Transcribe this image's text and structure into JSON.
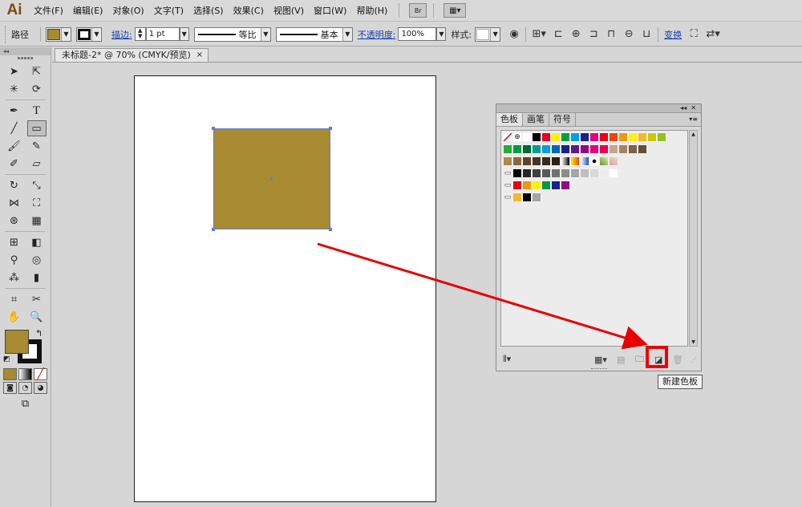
{
  "app": {
    "logo": "Ai"
  },
  "menu": {
    "items": [
      "文件(F)",
      "编辑(E)",
      "对象(O)",
      "文字(T)",
      "选择(S)",
      "效果(C)",
      "视图(V)",
      "窗口(W)",
      "帮助(H)"
    ],
    "bridge_label": "Br",
    "arrange_label": "▦▾"
  },
  "control": {
    "selection_label": "路径",
    "stroke_link": "描边:",
    "stroke_weight": "1 pt",
    "profile_label": "等比",
    "brush_label": "基本",
    "opacity_link": "不透明度:",
    "opacity_value": "100%",
    "style_label": "样式:",
    "transform_link": "变换"
  },
  "document": {
    "tab_title": "未标题-2* @ 70% (CMYK/预览)",
    "close_glyph": "×"
  },
  "colors": {
    "fill": "#a88a32",
    "selection": "#5b7bd8",
    "annotation": "#e60000"
  },
  "panel": {
    "tabs": [
      "色板",
      "画笔",
      "符号"
    ],
    "collapse_glyph": "◂◂",
    "close_glyph": "✕",
    "menu_glyph": "▾≡",
    "swatch_rows": [
      [
        "none",
        "register",
        "#ffffff",
        "#000000",
        "#e6001e",
        "#fff100",
        "#00a23e",
        "#00a0e9",
        "#1d2088",
        "#e4007f",
        "#e60012",
        "#e94709",
        "#f39800",
        "#fff100",
        "#f8b62d",
        "#c9ca00",
        "#8fc31f"
      ],
      [
        "#22ac38",
        "#009944",
        "#006934",
        "#009e96",
        "#00a0e9",
        "#0068b7",
        "#1d2088",
        "#601986",
        "#920783",
        "#e4007f",
        "#e5004f",
        "#c7a58e",
        "#a68365",
        "#826147",
        "#6a4d35"
      ],
      [
        "#b28850",
        "#8a6a3c",
        "#5e432a",
        "#4a3320",
        "#3b2a1a",
        "#2c1e13",
        "gradient-gray",
        "gradient-orange",
        "gradient-blue",
        "pattern-dots",
        "pattern-leaf",
        "pattern-flower"
      ],
      [
        "folder",
        "#000000",
        "#262626",
        "#404040",
        "#595959",
        "#737373",
        "#8c8c8c",
        "#a6a6a6",
        "#bfbfbf",
        "#d9d9d9",
        "#ececec",
        "#ffffff"
      ],
      [
        "folder",
        "#e60012",
        "#f39800",
        "#fff100",
        "#009944",
        "#1d2088",
        "#920783"
      ],
      [
        "folder",
        "#f8b62d",
        "#000000",
        "#a6a6a6"
      ]
    ],
    "bottom": {
      "library_icon": "library-menu-icon",
      "kinds_icon": "swatch-kinds-icon",
      "options_icon": "swatch-options-icon",
      "new_group_icon": "new-color-group-icon",
      "new_swatch_icon": "new-swatch-icon",
      "delete_icon": "delete-swatch-icon"
    }
  },
  "tooltip": "新建色板"
}
